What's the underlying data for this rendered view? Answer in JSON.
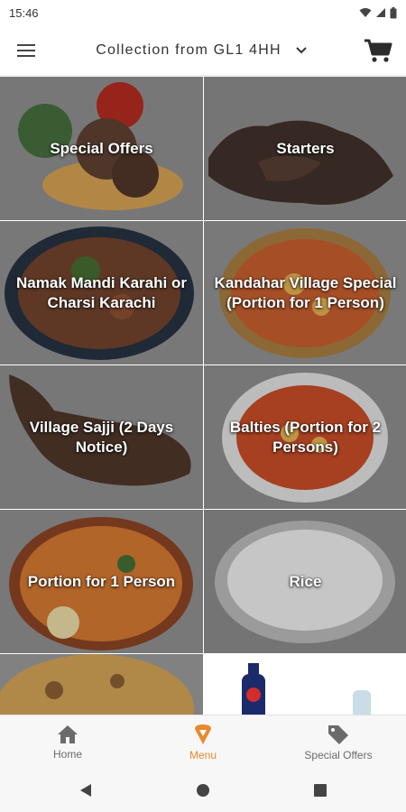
{
  "status_bar": {
    "time": "15:46"
  },
  "header": {
    "location": "Collection from GL1 4HH",
    "menu_icon": "hamburger-icon",
    "dropdown_icon": "chevron-down-icon",
    "cart_icon": "cart-icon"
  },
  "categories": [
    {
      "label": "Special Offers"
    },
    {
      "label": "Starters"
    },
    {
      "label": "Namak Mandi Karahi or Charsi Karachi"
    },
    {
      "label": "Kandahar Village Special (Portion for 1 Person)"
    },
    {
      "label": "Village Sajji (2 Days Notice)"
    },
    {
      "label": "Balties (Portion for 2 Persons)"
    },
    {
      "label": "Portion for 1 Person"
    },
    {
      "label": "Rice"
    },
    {
      "label": ""
    },
    {
      "label": ""
    }
  ],
  "bottom_nav": {
    "items": [
      {
        "label": "Home",
        "icon": "home-icon",
        "active": false
      },
      {
        "label": "Menu",
        "icon": "menu-pin-icon",
        "active": true
      },
      {
        "label": "Special Offers",
        "icon": "tag-icon",
        "active": false
      }
    ]
  },
  "system_nav": {
    "back": "back-icon",
    "home": "home-circle-icon",
    "recents": "recents-icon"
  },
  "colors": {
    "accent": "#e8892c",
    "text": "#333333",
    "tile_bg": "#8a8a8a"
  }
}
